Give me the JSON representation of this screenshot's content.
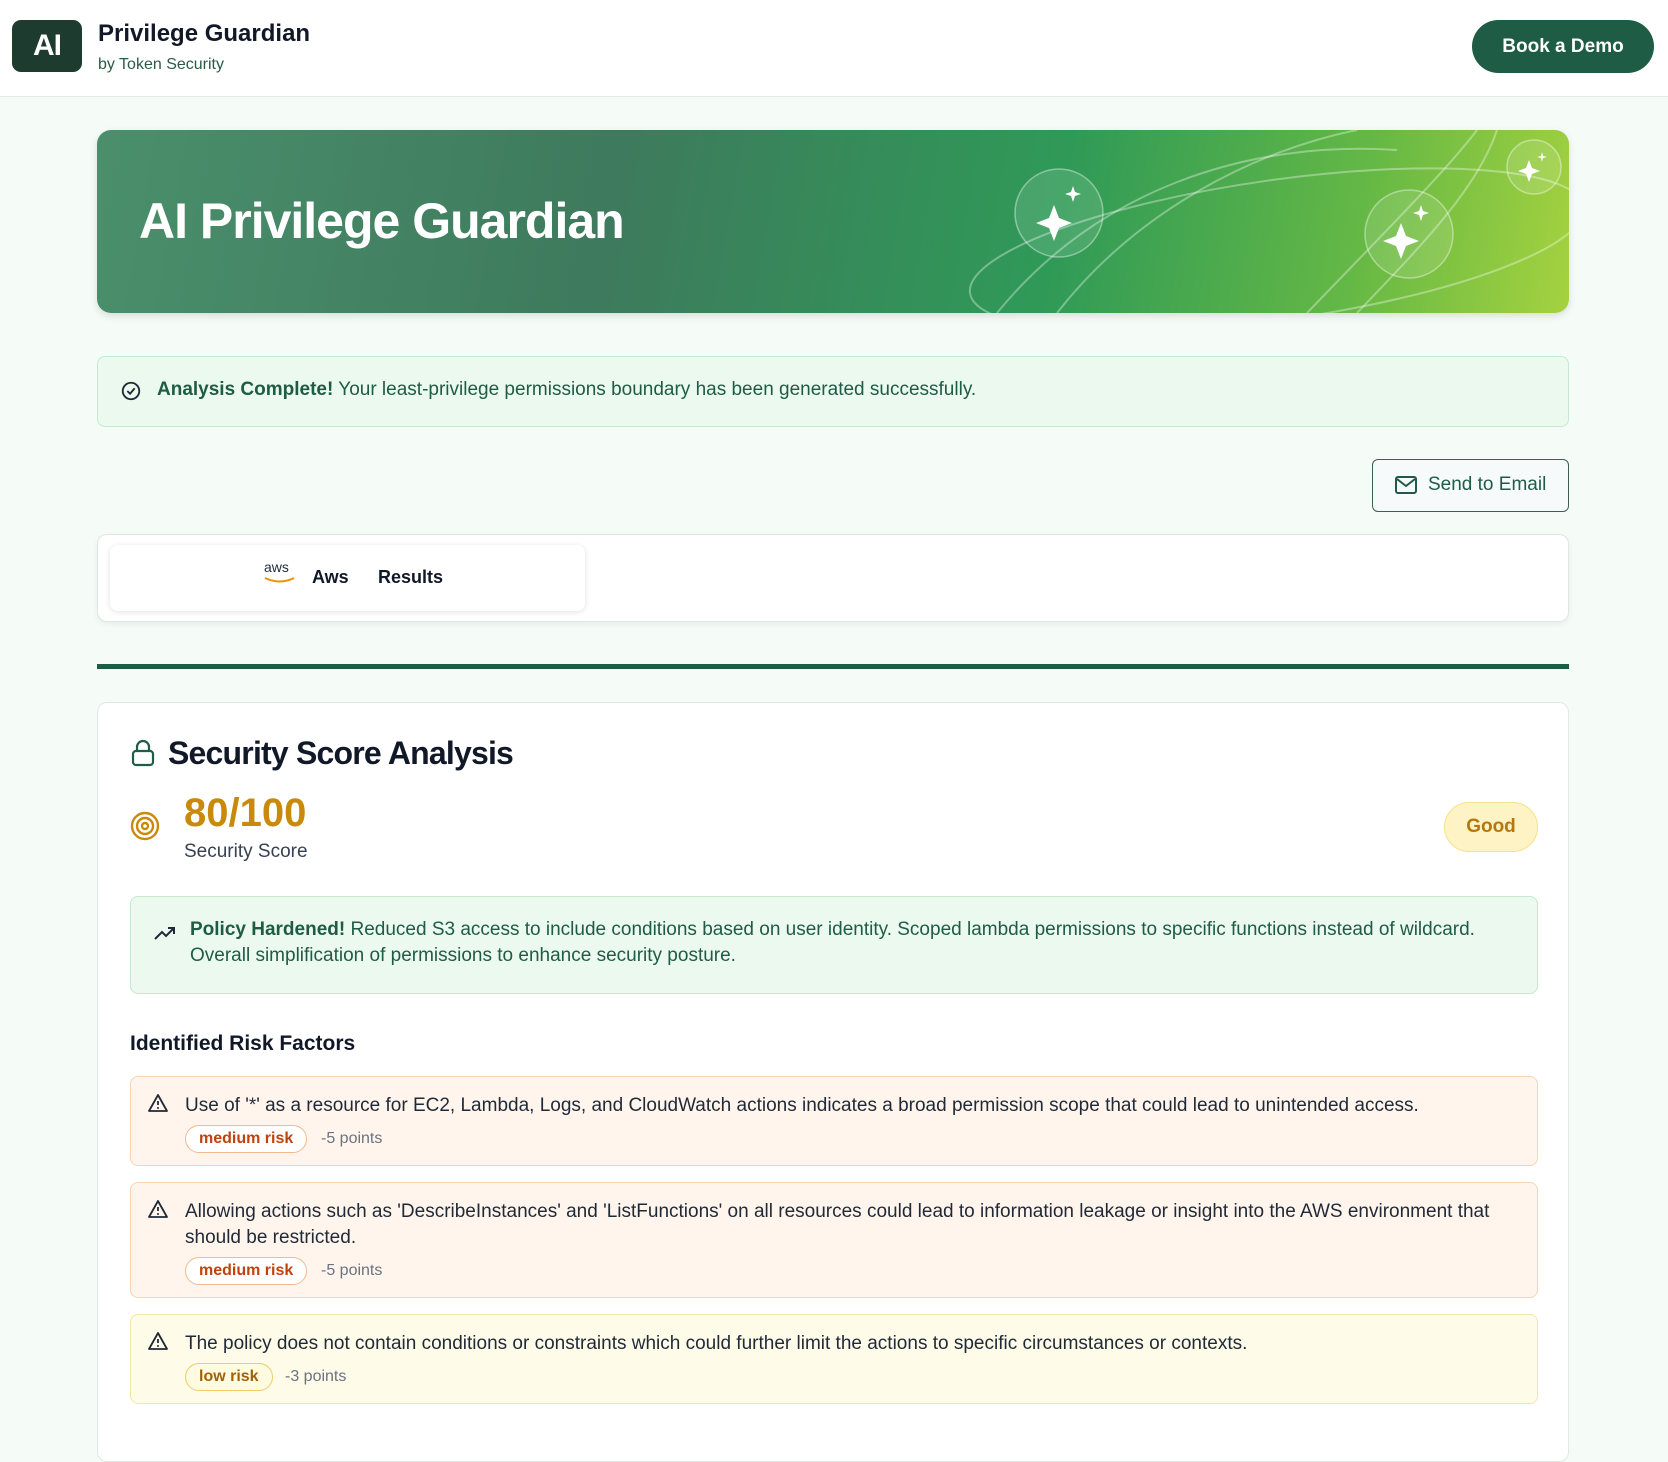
{
  "header": {
    "logo_text": "AI",
    "app_title": "Privilege Guardian",
    "app_subtitle": "by Token Security",
    "demo_button": "Book a Demo"
  },
  "hero": {
    "title": "AI Privilege Guardian"
  },
  "alert": {
    "title": "Analysis Complete!",
    "message": " Your least-privilege permissions boundary has been generated successfully."
  },
  "actions": {
    "send_email": "Send to Email"
  },
  "tabs": {
    "logo": "aws",
    "provider": "Aws",
    "label": "Results"
  },
  "security": {
    "title": "Security Score Analysis",
    "score": "80/100",
    "score_label": "Security Score",
    "rating": "Good",
    "hardened_title": "Policy Hardened!",
    "hardened_text": " Reduced S3 access to include conditions based on user identity. Scoped lambda permissions to specific functions instead of wildcard. Overall simplification of permissions to enhance security posture.",
    "risk_heading": "Identified Risk Factors",
    "risks": [
      {
        "description": "Use of '*' as a resource for EC2, Lambda, Logs, and CloudWatch actions indicates a broad permission scope that could lead to unintended access.",
        "level": "medium risk",
        "points": "-5 points"
      },
      {
        "description": "Allowing actions such as 'DescribeInstances' and 'ListFunctions' on all resources could lead to information leakage or insight into the AWS environment that should be restricted.",
        "level": "medium risk",
        "points": "-5 points"
      },
      {
        "description": "The policy does not contain conditions or constraints which could further limit the actions to specific circumstances or contexts.",
        "level": "low risk",
        "points": "-3 points"
      }
    ]
  },
  "colors": {
    "brand": "#1f5c45",
    "score": "#c98a0b",
    "medium_risk": "#c2410c",
    "low_risk": "#a16207"
  }
}
